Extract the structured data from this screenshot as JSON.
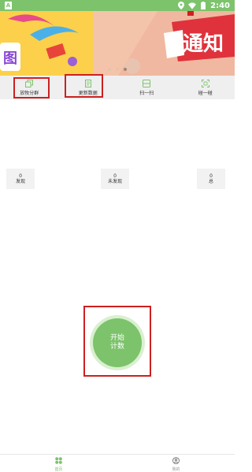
{
  "status_bar": {
    "notification_letter": "A",
    "time": "2:40"
  },
  "banner": {
    "slide_text": "通知",
    "dots": 3,
    "active_dot": 2
  },
  "menu": [
    {
      "label": "放牧分群",
      "icon": "copy-icon"
    },
    {
      "label": "更新数据",
      "icon": "document-icon"
    },
    {
      "label": "扫一扫",
      "icon": "scan-icon"
    },
    {
      "label": "碰一碰",
      "icon": "nfc-icon"
    }
  ],
  "stats": [
    {
      "value": "0",
      "label": "发现"
    },
    {
      "value": "0",
      "label": "未发现"
    },
    {
      "value": "0",
      "label": "总"
    }
  ],
  "start_button": {
    "line1": "开始",
    "line2": "计数"
  },
  "bottom_nav": [
    {
      "label": "首页",
      "icon": "home-grid-icon",
      "active": true
    },
    {
      "label": "我的",
      "icon": "person-icon",
      "active": false
    }
  ],
  "colors": {
    "accent": "#7cc36b",
    "highlight": "#cc2020"
  }
}
